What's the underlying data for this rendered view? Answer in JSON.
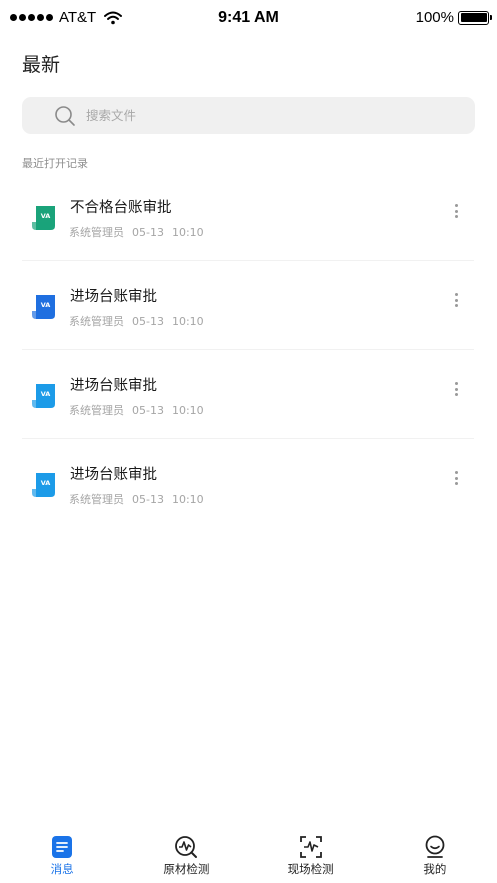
{
  "status_bar": {
    "carrier": "AT&T",
    "time": "9:41 AM",
    "battery": "100%"
  },
  "page": {
    "title": "最新"
  },
  "search": {
    "placeholder": "搜索文件",
    "value": ""
  },
  "section": {
    "label": "最近打开记录"
  },
  "files": [
    {
      "title": "不合格台账审批",
      "owner": "系统管理员",
      "date": "05-13",
      "time": "10:10",
      "icon": "ledger-file-icon",
      "color": "#1aa37a"
    },
    {
      "title": "进场台账审批",
      "owner": "系统管理员",
      "date": "05-13",
      "time": "10:10",
      "icon": "ledger-file-icon",
      "color": "#1f6fe0"
    },
    {
      "title": "进场台账审批",
      "owner": "系统管理员",
      "date": "05-13",
      "time": "10:10",
      "icon": "ledger-file-icon",
      "color": "#1c9be8"
    },
    {
      "title": "进场台账审批",
      "owner": "系统管理员",
      "date": "05-13",
      "time": "10:10",
      "icon": "ledger-file-icon",
      "color": "#1c9be8"
    }
  ],
  "tabs": [
    {
      "label": "消息",
      "icon": "message-icon",
      "active": true
    },
    {
      "label": "原材检测",
      "icon": "material-test-icon",
      "active": false
    },
    {
      "label": "现场检测",
      "icon": "site-scan-icon",
      "active": false
    },
    {
      "label": "我的",
      "icon": "profile-icon",
      "active": false
    }
  ],
  "colors": {
    "accent": "#1a73e8",
    "search_bg": "#f0f0f0",
    "meta_text": "#a5a5a5"
  }
}
